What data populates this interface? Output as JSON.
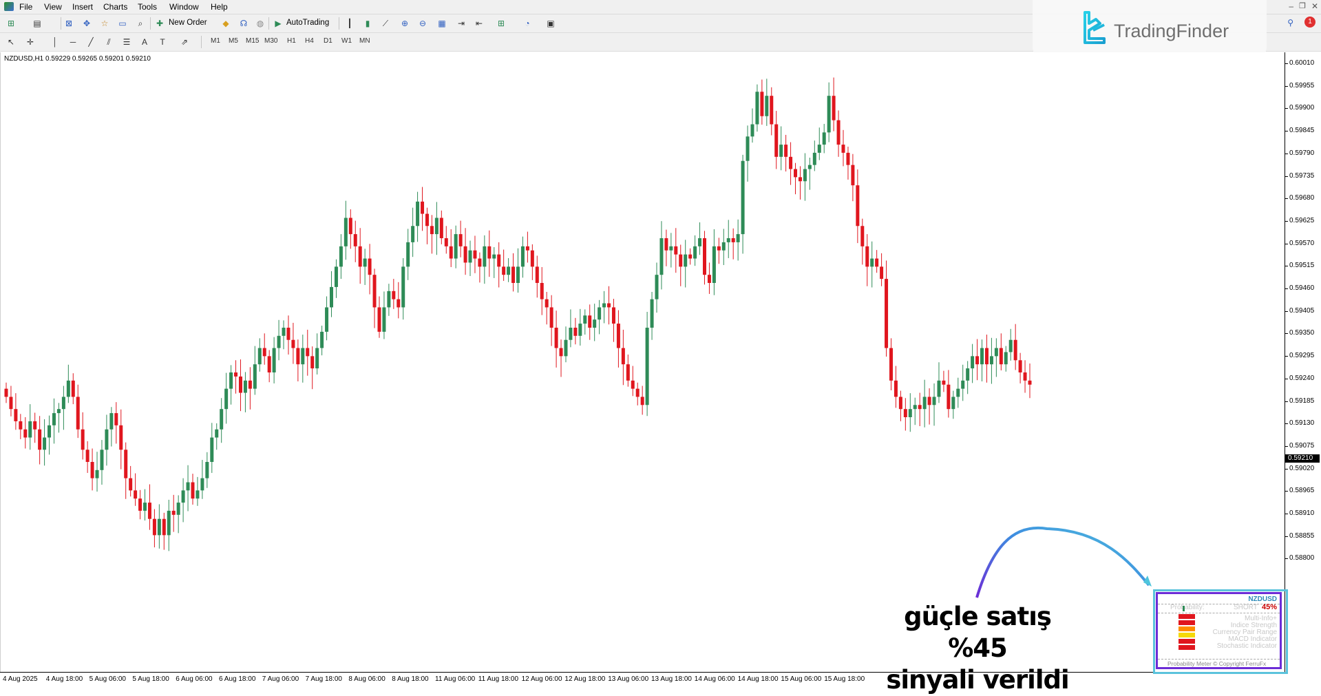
{
  "menu": {
    "items": [
      "File",
      "View",
      "Insert",
      "Charts",
      "Tools",
      "Window",
      "Help"
    ]
  },
  "toolbar": {
    "new_order_label": "New Order",
    "autotrading_label": "AutoTrading",
    "timeframes": [
      "M1",
      "M5",
      "M15",
      "M30",
      "H1",
      "H4",
      "D1",
      "W1",
      "MN"
    ]
  },
  "chart": {
    "symbol_info": "NZDUSD,H1  0.59229 0.59265 0.59201 0.59210",
    "current_price": "0.59210",
    "price_labels": [
      "0.60010",
      "0.59955",
      "0.59900",
      "0.59845",
      "0.59790",
      "0.59735",
      "0.59680",
      "0.59625",
      "0.59570",
      "0.59515",
      "0.59460",
      "0.59405",
      "0.59350",
      "0.59295",
      "0.59240",
      "0.59185",
      "0.59130",
      "0.59075",
      "0.59020",
      "0.58965",
      "0.58910",
      "0.58855",
      "0.58800"
    ],
    "time_labels": [
      "4 Aug 2025",
      "4 Aug 18:00",
      "5 Aug 06:00",
      "5 Aug 18:00",
      "6 Aug 06:00",
      "6 Aug 18:00",
      "7 Aug 06:00",
      "7 Aug 18:00",
      "8 Aug 06:00",
      "8 Aug 18:00",
      "11 Aug 06:00",
      "11 Aug 18:00",
      "12 Aug 06:00",
      "12 Aug 18:00",
      "13 Aug 06:00",
      "13 Aug 18:00",
      "14 Aug 06:00",
      "14 Aug 18:00",
      "15 Aug 06:00",
      "15 Aug 18:00"
    ],
    "bull_color": "#2e8b57",
    "bear_color": "#e0161e",
    "closes": [
      0.5918,
      0.5915,
      0.5912,
      0.591,
      0.5908,
      0.5912,
      0.591,
      0.5905,
      0.5908,
      0.5911,
      0.5914,
      0.5915,
      0.5918,
      0.5922,
      0.5918,
      0.591,
      0.5905,
      0.5902,
      0.5898,
      0.59,
      0.5905,
      0.591,
      0.5914,
      0.5911,
      0.5905,
      0.5898,
      0.5895,
      0.5893,
      0.589,
      0.5892,
      0.5888,
      0.5884,
      0.5888,
      0.5884,
      0.589,
      0.5889,
      0.5892,
      0.5895,
      0.5897,
      0.5893,
      0.5895,
      0.5898,
      0.5902,
      0.5908,
      0.591,
      0.5915,
      0.592,
      0.5924,
      0.5923,
      0.5919,
      0.5922,
      0.592,
      0.5926,
      0.593,
      0.5928,
      0.5924,
      0.593,
      0.5933,
      0.5935,
      0.5932,
      0.593,
      0.5926,
      0.593,
      0.5928,
      0.5925,
      0.593,
      0.5934,
      0.594,
      0.5945,
      0.595,
      0.5955,
      0.5962,
      0.5958,
      0.5955,
      0.595,
      0.5952,
      0.5948,
      0.594,
      0.5934,
      0.594,
      0.5944,
      0.5942,
      0.594,
      0.595,
      0.5956,
      0.596,
      0.5966,
      0.5963,
      0.596,
      0.5958,
      0.5962,
      0.5957,
      0.5955,
      0.5952,
      0.5958,
      0.5955,
      0.5951,
      0.5954,
      0.5952,
      0.595,
      0.5955,
      0.5952,
      0.5953,
      0.595,
      0.5948,
      0.595,
      0.5946,
      0.595,
      0.5955,
      0.5954,
      0.595,
      0.5946,
      0.5942,
      0.594,
      0.5935,
      0.593,
      0.5928,
      0.5932,
      0.5935,
      0.5933,
      0.5936,
      0.5938,
      0.5935,
      0.5937,
      0.594,
      0.5941,
      0.594,
      0.5936,
      0.593,
      0.5926,
      0.5922,
      0.592,
      0.5918,
      0.5916,
      0.5935,
      0.5942,
      0.5948,
      0.5957,
      0.5954,
      0.5955,
      0.5953,
      0.595,
      0.5953,
      0.5952,
      0.5955,
      0.5957,
      0.5948,
      0.5946,
      0.5955,
      0.5954,
      0.5956,
      0.5957,
      0.5956,
      0.5958,
      0.5976,
      0.5982,
      0.5985,
      0.5993,
      0.5987,
      0.5992,
      0.5985,
      0.5977,
      0.598,
      0.5977,
      0.5974,
      0.5972,
      0.5971,
      0.5974,
      0.5975,
      0.5978,
      0.598,
      0.5983,
      0.5992,
      0.5986,
      0.598,
      0.5978,
      0.5975,
      0.597,
      0.596,
      0.5955,
      0.595,
      0.5952,
      0.595,
      0.5947,
      0.593,
      0.5922,
      0.5918,
      0.5915,
      0.5913,
      0.5915,
      0.5916,
      0.5915,
      0.5918,
      0.5916,
      0.5918,
      0.5922,
      0.5921,
      0.5915,
      0.5918,
      0.592,
      0.5922,
      0.5925,
      0.5928,
      0.5926,
      0.593,
      0.5926,
      0.5928,
      0.593,
      0.5926,
      0.5929,
      0.5932,
      0.5927,
      0.5924,
      0.5922,
      0.5921
    ]
  },
  "logo": {
    "brand": "TradingFinder"
  },
  "annotation": {
    "line1": "güçle satış %45",
    "line2": "sinyali verildi"
  },
  "panel": {
    "symbol": "NZDUSD",
    "probability_label": "Probability:",
    "direction": "SHORT",
    "percent": "45%",
    "rows": [
      "Multi-Info+",
      "Indice Strength",
      "Currency Pair Range",
      "MACD Indicator",
      "Stochastic Indicator"
    ],
    "footer": "Probability Meter © Copyright FerruFx",
    "colors": {
      "symbol": "#2e8bb8",
      "percent": "#cc0000",
      "bar_red": "#e0161e",
      "bar_orange": "#ff8c00",
      "bar_yellow": "#f5d90a",
      "border_outer": "#5bc3dc",
      "border_inner": "#6c2cd6"
    }
  }
}
